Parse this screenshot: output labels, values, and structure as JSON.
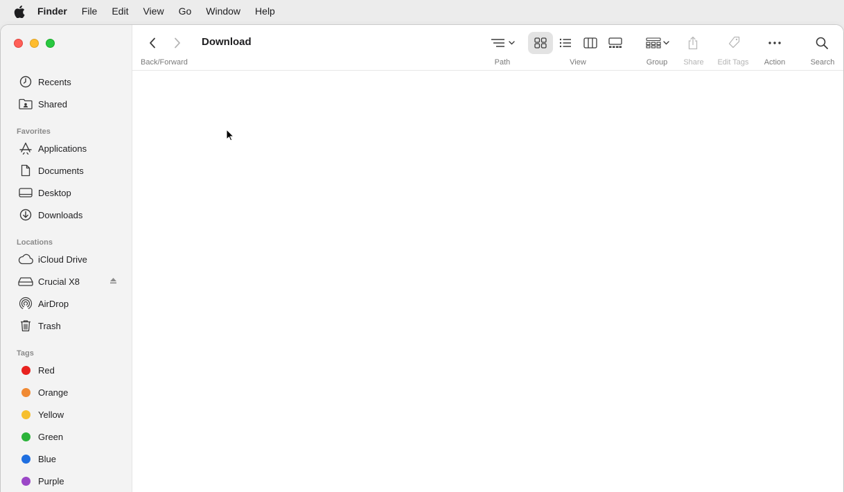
{
  "menubar": {
    "app_name": "Finder",
    "items": [
      "File",
      "Edit",
      "View",
      "Go",
      "Window",
      "Help"
    ]
  },
  "window": {
    "title": "Download",
    "toolbar": {
      "back_forward_label": "Back/Forward",
      "path_label": "Path",
      "view_label": "View",
      "group_label": "Group",
      "share_label": "Share",
      "edit_tags_label": "Edit Tags",
      "action_label": "Action",
      "search_label": "Search",
      "active_view": "icon-view"
    }
  },
  "sidebar": {
    "top_items": [
      {
        "label": "Recents",
        "icon": "clock-icon"
      },
      {
        "label": "Shared",
        "icon": "shared-folder-icon"
      }
    ],
    "favorites_heading": "Favorites",
    "favorites": [
      {
        "label": "Applications",
        "icon": "applications-icon"
      },
      {
        "label": "Documents",
        "icon": "document-icon"
      },
      {
        "label": "Desktop",
        "icon": "desktop-icon"
      },
      {
        "label": "Downloads",
        "icon": "download-icon"
      }
    ],
    "locations_heading": "Locations",
    "locations": [
      {
        "label": "iCloud Drive",
        "icon": "cloud-icon"
      },
      {
        "label": "Crucial X8",
        "icon": "drive-icon"
      },
      {
        "label": "AirDrop",
        "icon": "airdrop-icon"
      },
      {
        "label": "Trash",
        "icon": "trash-icon"
      }
    ],
    "tags_heading": "Tags",
    "tags": [
      {
        "label": "Red",
        "color": "#e8221f"
      },
      {
        "label": "Orange",
        "color": "#f08a34"
      },
      {
        "label": "Yellow",
        "color": "#f6bf2e"
      },
      {
        "label": "Green",
        "color": "#2bb33a"
      },
      {
        "label": "Blue",
        "color": "#1f6fe0"
      },
      {
        "label": "Purple",
        "color": "#9b47c7"
      }
    ]
  }
}
